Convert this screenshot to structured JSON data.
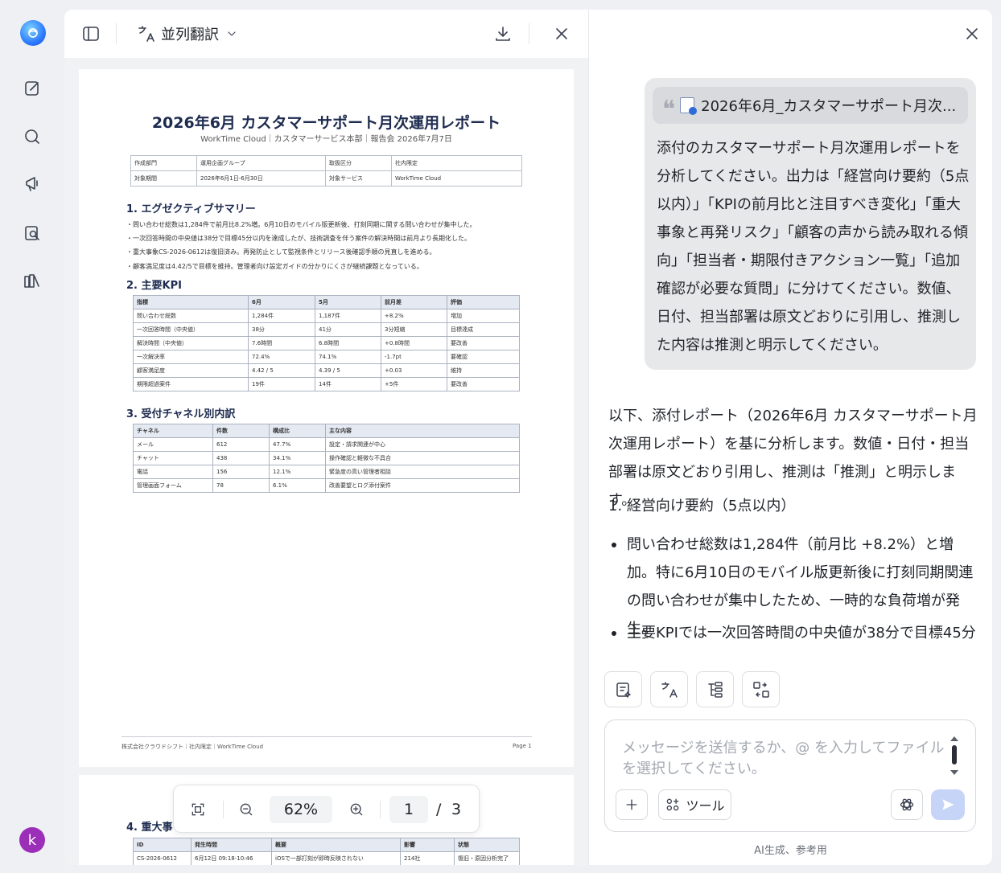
{
  "toolbar": {
    "mode_label": "並列翻訳"
  },
  "pdf": {
    "title": "2026年6月 カスタマーサポート月次運用レポート",
    "subtitle": "WorkTime Cloud｜カスタマーサービス本部｜報告会 2026年7月7日",
    "meta": [
      [
        "作成部門",
        "運用企画グループ",
        "取扱区分",
        "社内限定"
      ],
      [
        "対象期間",
        "2026年6月1日-6月30日",
        "対象サービス",
        "WorkTime Cloud"
      ]
    ],
    "section1_title": "1. エグゼクティブサマリー",
    "section1_bullets": [
      "・問い合わせ総数は1,284件で前月比8.2%増。6月10日のモバイル版更新後、打刻同期に関する問い合わせが集中した。",
      "・一次回答時間の中央値は38分で目標45分以内を達成したが、技術調査を伴う案件の解決時間は前月より長期化した。",
      "・重大事象CS-2026-0612は復旧済み。再発防止として監視条件とリリース後確認手順の見直しを進める。",
      "・顧客満足度は4.42/5で目標を維持。管理者向け設定ガイドの分かりにくさが継続課題となっている。"
    ],
    "section2_title": "2. 主要KPI",
    "kpi_headers": [
      "指標",
      "6月",
      "5月",
      "前月差",
      "評価"
    ],
    "kpi_rows": [
      [
        "問い合わせ総数",
        "1,284件",
        "1,187件",
        "+8.2%",
        "増加"
      ],
      [
        "一次回答時間（中央値）",
        "38分",
        "41分",
        "3分短縮",
        "目標達成"
      ],
      [
        "解決時間（中央値）",
        "7.6時間",
        "6.8時間",
        "+0.8時間",
        "要改善"
      ],
      [
        "一次解決率",
        "72.4%",
        "74.1%",
        "-1.7pt",
        "要確認"
      ],
      [
        "顧客満足度",
        "4.42 / 5",
        "4.39 / 5",
        "+0.03",
        "維持"
      ],
      [
        "期限超過案件",
        "19件",
        "14件",
        "+5件",
        "要改善"
      ]
    ],
    "section3_title": "3. 受付チャネル別内訳",
    "ch_headers": [
      "チャネル",
      "件数",
      "構成比",
      "主な内容"
    ],
    "ch_rows": [
      [
        "メール",
        "612",
        "47.7%",
        "設定・請求関連が中心"
      ],
      [
        "チャット",
        "438",
        "34.1%",
        "操作確認と軽微な不具合"
      ],
      [
        "電話",
        "156",
        "12.1%",
        "緊急度の高い管理者相談"
      ],
      [
        "管理画面フォーム",
        "78",
        "6.1%",
        "改善要望とログ添付案件"
      ]
    ],
    "footer_left": "株式会社クラウドシフト｜社内限定｜WorkTime Cloud",
    "footer_right": "Page 1",
    "section4_title": "4. 重大事",
    "inc_headers": [
      "ID",
      "発生時間",
      "概要",
      "影響",
      "状態"
    ],
    "inc_rows": [
      [
        "CS-2026-0612",
        "6月12日 09:18-10:46",
        "iOSで一部打刻が即時反映されない",
        "214社",
        "復旧・原因分析完了"
      ]
    ]
  },
  "zoom": {
    "percent": "62%",
    "page_current": "1",
    "page_sep": "/",
    "page_total": "3"
  },
  "chat": {
    "attachment_name": "2026年6月_カスタマーサポート月次...",
    "user_message": "添付のカスタマーサポート月次運用レポートを分析してください。出力は「経営向け要約（5点以内）」「KPIの前月比と注目すべき変化」「重大事象と再発リスク」「顧客の声から読み取れる傾向」「担当者・期限付きアクション一覧」「追加確認が必要な質問」に分けてください。数値、日付、担当部署は原文どおりに引用し、推測した内容は推測と明示してください。",
    "ai_intro": "以下、添付レポート（2026年6月 カスタマーサポート月次運用レポート）を基に分析します。数値・日付・担当部署は原文どおり引用し、推測は「推測」と明示します。",
    "ai_heading": "1. 経営向け要約（5点以内）",
    "ai_bullets": [
      "問い合わせ総数は1,284件（前月比 +8.2%）と増加。特に6月10日のモバイル版更新後に打刻同期関連の問い合わせが集中したため、一時的な負荷増が発生。",
      "主要KPIでは一次回答時間の中央値が38分で目標45分"
    ],
    "placeholder": "メッセージを送信するか、@ を入力してファイルを選択してください。",
    "tool_label": "ツール",
    "disclaimer": "AI生成、参考用"
  },
  "user": {
    "avatar_letter": "k"
  },
  "colors": {
    "accent": "#2e6bd8",
    "send_disabled": "#c6d4f8",
    "avatar": "#9b2fb8"
  }
}
